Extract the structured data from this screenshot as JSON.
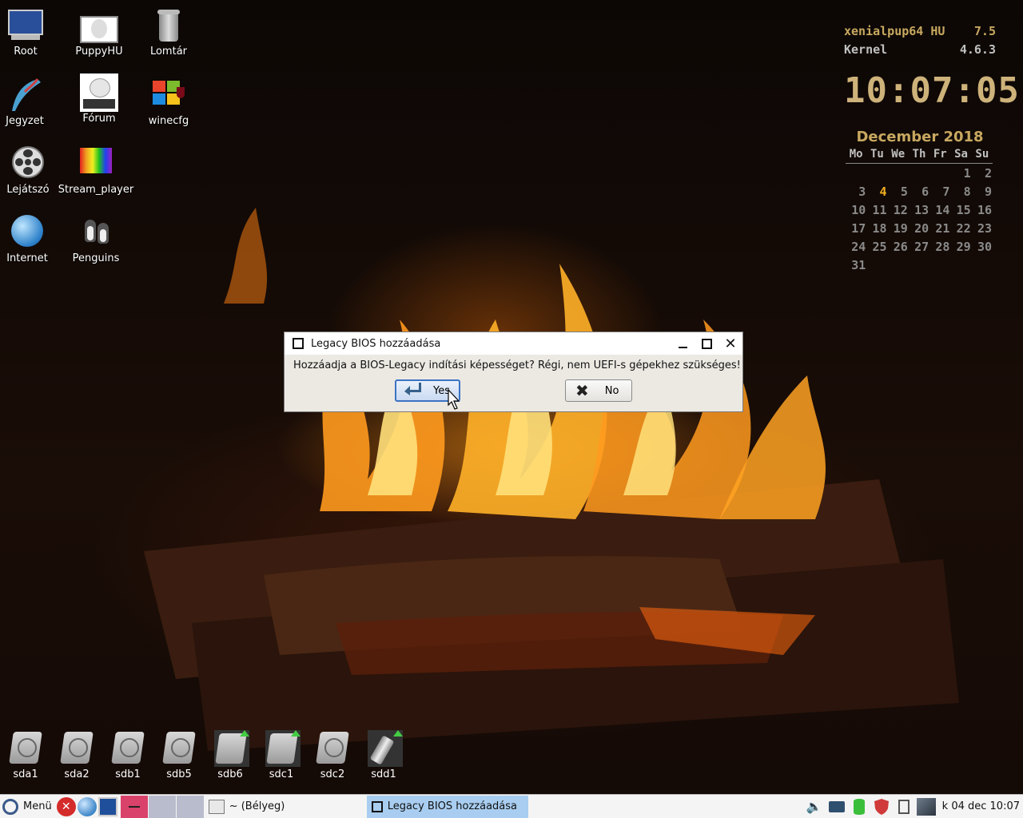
{
  "desktop_icons": [
    {
      "label": "Root",
      "icon": "monitor-icon"
    },
    {
      "label": "PuppyHU",
      "icon": "puppy-photo-icon"
    },
    {
      "label": "Lomtár",
      "icon": "trash-icon"
    },
    {
      "label": "Jegyzet",
      "icon": "quill-pen-icon"
    },
    {
      "label": "Fórum",
      "icon": "puppy-linux-logo-icon"
    },
    {
      "label": "winecfg",
      "icon": "wine-windows-icon"
    },
    {
      "label": "Lejátszó",
      "icon": "film-reel-icon"
    },
    {
      "label": "Stream_player",
      "icon": "rainbow-gradient-icon"
    },
    {
      "label": "Internet",
      "icon": "globe-icon"
    },
    {
      "label": "Penguins",
      "icon": "penguins-icon"
    }
  ],
  "conky": {
    "distro": "xenialpup64 HU",
    "version": "7.5",
    "kernel_label": "Kernel",
    "kernel_version": "4.6.3",
    "time": "10:07:05",
    "month_title": "December  2018",
    "weekdays": [
      "Mo",
      "Tu",
      "We",
      "Th",
      "Fr",
      "Sa",
      "Su"
    ],
    "weeks": [
      [
        "",
        "",
        "",
        "",
        "",
        "1",
        "2"
      ],
      [
        "3",
        "4",
        "5",
        "6",
        "7",
        "8",
        "9"
      ],
      [
        "10",
        "11",
        "12",
        "13",
        "14",
        "15",
        "16"
      ],
      [
        "17",
        "18",
        "19",
        "20",
        "21",
        "22",
        "23"
      ],
      [
        "24",
        "25",
        "26",
        "27",
        "28",
        "29",
        "30"
      ],
      [
        "31",
        "",
        "",
        "",
        "",
        "",
        ""
      ]
    ],
    "today": "4"
  },
  "dialog": {
    "title": "Legacy BIOS hozzáadása",
    "message": "Hozzáadja a BIOS-Legacy indítási képességet? Régi, nem UEFI-s gépekhez szükséges!",
    "yes_label": "Yes",
    "no_label": "No"
  },
  "drives": [
    "sda1",
    "sda2",
    "sdb1",
    "sdb5",
    "sdb6",
    "sdc1",
    "sdc2",
    "sdd1"
  ],
  "taskbar": {
    "menu_label": "Menü",
    "tasks": [
      {
        "label": "~ (Bélyeg)",
        "active": false
      },
      {
        "label": "Legacy BIOS hozzáadása",
        "active": true
      }
    ],
    "clock": "k 04 dec 10:07"
  },
  "colors": {
    "conky_gold": "#c8a860",
    "today_highlight": "#f2b020",
    "active_task": "#a8cdf0",
    "yes_focus": "#3b73c4"
  }
}
